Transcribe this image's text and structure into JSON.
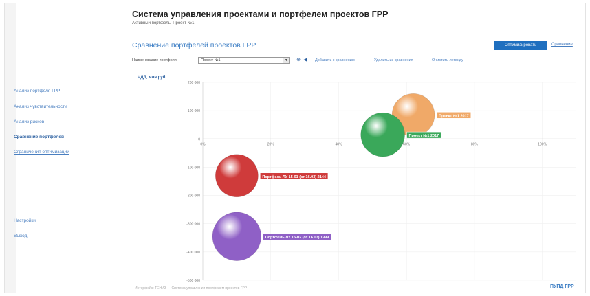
{
  "header": {
    "title": "Система управления проектами и портфелем проектов ГРР",
    "subtitle": "Активный портфель: Проект №1"
  },
  "sidebar": {
    "items": [
      {
        "label": "Анализ портфеля ГРР",
        "active": false
      },
      {
        "label": "Анализ чувствительности",
        "active": false
      },
      {
        "label": "Анализ рисков",
        "active": false
      },
      {
        "label": "Сравнение портфелей",
        "active": true
      },
      {
        "label": "Ограничения оптимизации",
        "active": false
      },
      {
        "label": "Настройки",
        "active": false
      },
      {
        "label": "Выход",
        "active": false
      }
    ]
  },
  "main": {
    "title": "Сравнение портфелей проектов ГРР",
    "primary_button": "Оптимизировать",
    "top_link": "Сравнение",
    "toolbar": {
      "label": "Наименование портфеля:",
      "select_value": "Проект №1",
      "links": [
        "Добавить к сравнению",
        "Удалить из сравнения",
        "Очистить легенду"
      ]
    },
    "ylabel": "ЧДД, млн руб."
  },
  "footer": {
    "left": "Интерфейс: ТЕНИЗ — Система управления портфелем проектов ГРР",
    "right": "ПУПД ГРР"
  },
  "colors": {
    "accent": "#1f6fbf",
    "link": "#4a7fc0",
    "bubble_orange": "#f0a968",
    "bubble_green": "#3aa85a",
    "bubble_red": "#cf3b3b",
    "bubble_purple": "#8f60c6"
  },
  "chart_data": {
    "type": "scatter",
    "x_ticks": [
      "0%",
      "20%",
      "40%",
      "60%",
      "80%",
      "100%"
    ],
    "y_ticks": [
      "200 000",
      "100 000",
      "0",
      "-100 000",
      "-200 000",
      "-300 000",
      "-400 000",
      "-500 000"
    ],
    "xlim": [
      0,
      110
    ],
    "ylim": [
      -500000,
      200000
    ],
    "grid": true,
    "series": [
      {
        "name": "Проект №1 2017",
        "x": 62,
        "y": 85000,
        "size": 1.0,
        "color": "#f0a968"
      },
      {
        "name": "Проект №1 2017",
        "x": 53,
        "y": 15000,
        "size": 1.03,
        "color": "#3aa85a"
      },
      {
        "name": "Портфель ЛУ 15-01 (от 16.03) 2144",
        "x": 10,
        "y": -130000,
        "size": 1.0,
        "color": "#cf3b3b"
      },
      {
        "name": "Портфель ЛУ 15-02 (от 16.03) 1999",
        "x": 10,
        "y": -345000,
        "size": 1.14,
        "color": "#8f60c6"
      }
    ]
  }
}
